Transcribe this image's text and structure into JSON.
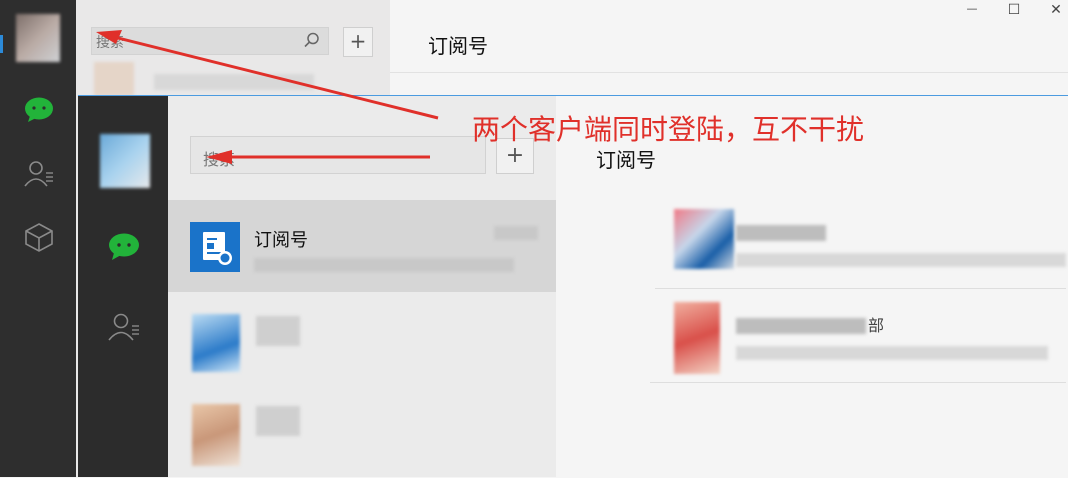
{
  "annotation": {
    "text": "两个客户端同时登陆，互不干扰",
    "color": "#e0302a"
  },
  "back_window": {
    "search": {
      "placeholder": "搜索",
      "icon": "search-icon"
    },
    "add_label": "+",
    "header_title": "订阅号",
    "window_controls": {
      "minimize": "—",
      "maximize": "☐",
      "close": "✕"
    },
    "nav_icons": [
      "avatar",
      "chat-icon",
      "contacts-icon",
      "cube-icon"
    ]
  },
  "front_window": {
    "search": {
      "placeholder": "搜索"
    },
    "add_label": "+",
    "header_title": "订阅号",
    "nav_icons": [
      "avatar",
      "chat-icon",
      "contacts-icon"
    ],
    "chat_list": [
      {
        "name": "订阅号",
        "icon": "subscription-icon",
        "selected": true
      },
      {
        "name": "",
        "icon": "avatar"
      },
      {
        "name": "",
        "icon": "avatar"
      }
    ],
    "articles": [
      {
        "title_fragment": ""
      },
      {
        "title_fragment": "部"
      }
    ]
  },
  "colors": {
    "chat_green": "#22b33a",
    "accent_blue": "#1a73c9",
    "sidebar_dark": "#2e2e2e"
  }
}
